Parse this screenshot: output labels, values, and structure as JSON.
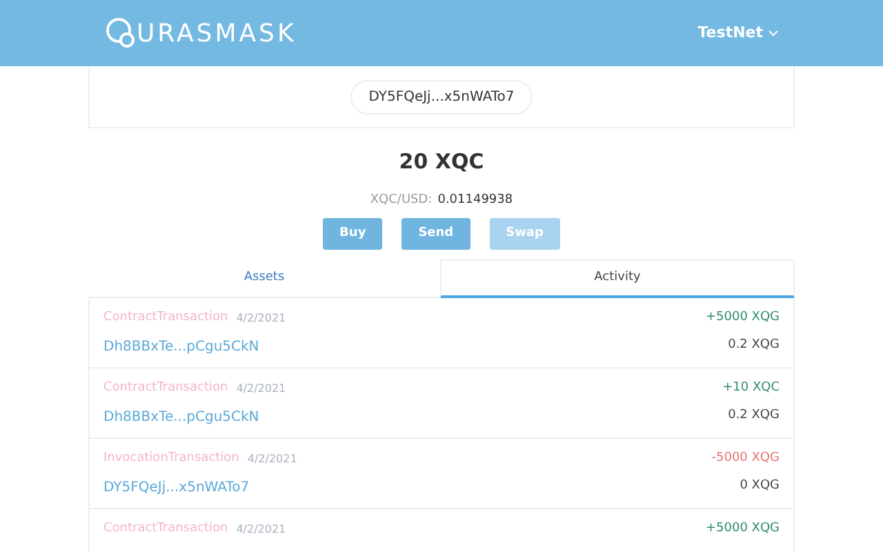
{
  "header": {
    "logo_text": "URASMASK",
    "network": "TestNet"
  },
  "account": {
    "address": "DY5FQeJj...x5nWATo7"
  },
  "balance": {
    "amount": "20 XQC",
    "rate_label": "XQC/USD:",
    "rate_value": "0.01149938"
  },
  "actions": [
    {
      "label": "Buy",
      "disabled": false
    },
    {
      "label": "Send",
      "disabled": false
    },
    {
      "label": "Swap",
      "disabled": true
    }
  ],
  "tabs": [
    {
      "label": "Assets",
      "selected": false
    },
    {
      "label": "Activity",
      "selected": true
    }
  ],
  "transactions": [
    {
      "type": "ContractTransaction",
      "date": "4/2/2021",
      "amount": "+5000 XQG",
      "outgoing": false,
      "address": "Dh8BBxTe...pCgu5CkN",
      "fee": "0.2 XQG"
    },
    {
      "type": "ContractTransaction",
      "date": "4/2/2021",
      "amount": "+10 XQC",
      "outgoing": false,
      "address": "Dh8BBxTe...pCgu5CkN",
      "fee": "0.2 XQG"
    },
    {
      "type": "InvocationTransaction",
      "date": "4/2/2021",
      "amount": "-5000 XQG",
      "outgoing": true,
      "address": "DY5FQeJj...x5nWATo7",
      "fee": "0 XQG"
    },
    {
      "type": "ContractTransaction",
      "date": "4/2/2021",
      "amount": "+5000 XQG",
      "outgoing": false
    }
  ]
}
